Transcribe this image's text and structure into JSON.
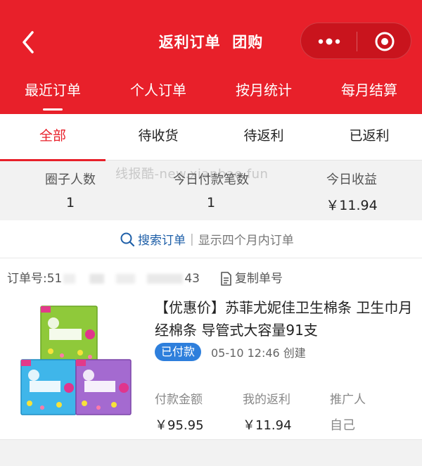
{
  "header": {
    "title": "返利订单  团购",
    "back_icon": "chevron-left-icon",
    "capsule": {
      "more_icon": "more-dots-icon",
      "close_icon": "target-circle-icon"
    },
    "bg_color": "#e8202a"
  },
  "top_tabs": [
    {
      "label": "最近订单",
      "active": true
    },
    {
      "label": "个人订单",
      "active": false
    },
    {
      "label": "按月统计",
      "active": false
    },
    {
      "label": "每月结算",
      "active": false
    }
  ],
  "sub_tabs": [
    {
      "label": "全部",
      "active": true
    },
    {
      "label": "待收货",
      "active": false
    },
    {
      "label": "待返利",
      "active": false
    },
    {
      "label": "已返利",
      "active": false
    }
  ],
  "stats": {
    "watermark": "线报酷-new.xianbao.fun",
    "items": [
      {
        "label": "圈子人数",
        "value": "1"
      },
      {
        "label": "今日付款笔数",
        "value": "1"
      },
      {
        "label": "今日收益",
        "value": "￥11.94"
      }
    ]
  },
  "search": {
    "link_label": "搜索订单",
    "hint": "显示四个月内订单"
  },
  "order": {
    "order_no_prefix": "订单号:51",
    "order_no_suffix": "43",
    "copy_label": "复制单号",
    "product_title": "【优惠价】苏菲尤妮佳卫生棉条 卫生巾月经棉条 导管式大容量91支",
    "status": "已付款",
    "created": "05-10 12:46 创建",
    "fields": [
      {
        "label": "付款金额",
        "value": "￥95.95"
      },
      {
        "label": "我的返利",
        "value": "￥11.94"
      },
      {
        "label": "推广人",
        "value": "自己"
      }
    ]
  },
  "colors": {
    "accent": "#e8202a",
    "link": "#1e5fa8",
    "badge": "#2e7fdc"
  }
}
